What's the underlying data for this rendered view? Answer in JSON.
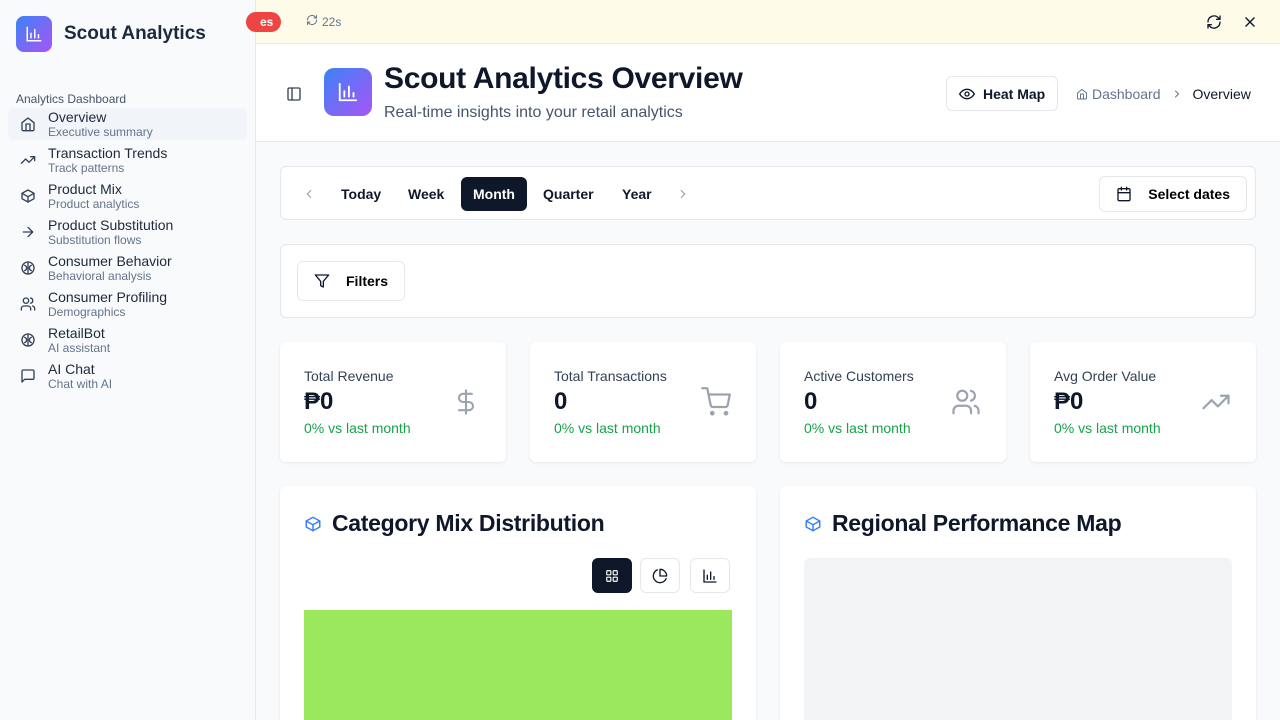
{
  "sidebar": {
    "brand": "Scout Analytics",
    "section_label": "Analytics Dashboard",
    "items": [
      {
        "title": "Overview",
        "subtitle": "Executive summary",
        "icon": "home-icon",
        "active": true
      },
      {
        "title": "Transaction Trends",
        "subtitle": "Track patterns",
        "icon": "trending-up-icon"
      },
      {
        "title": "Product Mix",
        "subtitle": "Product analytics",
        "icon": "package-icon"
      },
      {
        "title": "Product Substitution",
        "subtitle": "Substitution flows",
        "icon": "arrow-right-icon"
      },
      {
        "title": "Consumer Behavior",
        "subtitle": "Behavioral analysis",
        "icon": "brain-icon"
      },
      {
        "title": "Consumer Profiling",
        "subtitle": "Demographics",
        "icon": "users-icon"
      },
      {
        "title": "RetailBot",
        "subtitle": "AI assistant",
        "icon": "brain-icon"
      },
      {
        "title": "AI Chat",
        "subtitle": "Chat with AI",
        "icon": "message-square-icon"
      }
    ]
  },
  "banner": {
    "pill_text": "es",
    "refresh_text": "22s"
  },
  "header": {
    "title": "Scout Analytics Overview",
    "subtitle": "Real-time insights into your retail analytics",
    "heatmap_label": "Heat Map",
    "breadcrumb": {
      "home": "Dashboard",
      "current": "Overview"
    }
  },
  "period": {
    "options": [
      "Today",
      "Week",
      "Month",
      "Quarter",
      "Year"
    ],
    "selected": "Month",
    "dates_label": "Select dates"
  },
  "filters": {
    "label": "Filters"
  },
  "kpis": [
    {
      "label": "Total Revenue",
      "value": "₱0",
      "delta": "0% vs last month",
      "icon": "dollar-sign-icon"
    },
    {
      "label": "Total Transactions",
      "value": "0",
      "delta": "0% vs last month",
      "icon": "shopping-cart-icon"
    },
    {
      "label": "Active Customers",
      "value": "0",
      "delta": "0% vs last month",
      "icon": "users-icon"
    },
    {
      "label": "Avg Order Value",
      "value": "₱0",
      "delta": "0% vs last month",
      "icon": "trending-up-icon"
    }
  ],
  "cards": {
    "category_title": "Category Mix Distribution",
    "regional_title": "Regional Performance Map"
  },
  "colors": {
    "accent_dark": "#0f172a",
    "positive": "#16a34a",
    "treemap_fill": "#9be85e",
    "brand_gradient_start": "#3b82f6",
    "brand_gradient_end": "#a855f7",
    "alert": "#ef4444"
  }
}
